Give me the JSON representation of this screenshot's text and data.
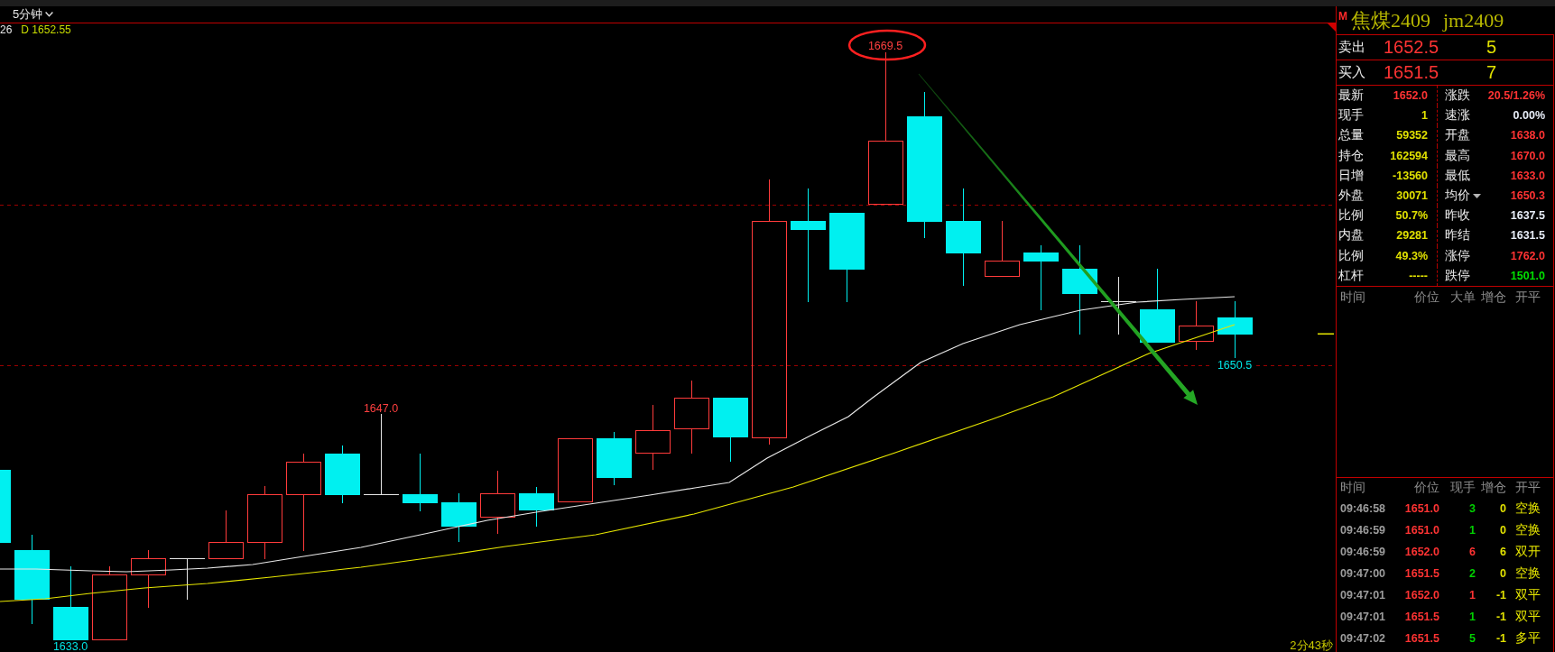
{
  "chart": {
    "timeframe": "5分钟",
    "indicator": {
      "prefix": "26",
      "value": "D 1652.55"
    },
    "price_labels": [
      {
        "kind": "high",
        "text": "1669.5",
        "circled": true
      },
      {
        "kind": "low",
        "text": "1650.5",
        "circled": false
      },
      {
        "kind": "high",
        "text": "1647.0",
        "circled": false
      },
      {
        "kind": "low",
        "text": "1633.0",
        "circled": false
      }
    ],
    "countdown": "2分43秒"
  },
  "quote": {
    "badge": "M",
    "name": "焦煤2409",
    "code": "jm2409",
    "ask": {
      "label": "卖出",
      "price": "1652.5",
      "volume": "5"
    },
    "bid": {
      "label": "买入",
      "price": "1651.5",
      "volume": "7"
    },
    "stats": [
      {
        "label": "最新",
        "value": "1652.0",
        "color": "#ff3333",
        "dropdown": false
      },
      {
        "label": "涨跌",
        "value": "20.5/1.26%",
        "color": "#ff3333",
        "dropdown": false
      },
      {
        "label": "现手",
        "value": "1",
        "color": "#e0e000",
        "dropdown": false
      },
      {
        "label": "速涨",
        "value": "0.00%",
        "color": "#e8eef8",
        "dropdown": false
      },
      {
        "label": "总量",
        "value": "59352",
        "color": "#e0e000",
        "dropdown": false
      },
      {
        "label": "开盘",
        "value": "1638.0",
        "color": "#ff3333",
        "dropdown": false
      },
      {
        "label": "持仓",
        "value": "162594",
        "color": "#e0e000",
        "dropdown": false
      },
      {
        "label": "最高",
        "value": "1670.0",
        "color": "#ff3333",
        "dropdown": false
      },
      {
        "label": "日增",
        "value": "-13560",
        "color": "#e0e000",
        "dropdown": false
      },
      {
        "label": "最低",
        "value": "1633.0",
        "color": "#ff3333",
        "dropdown": false
      },
      {
        "label": "外盘",
        "value": "30071",
        "color": "#e0e000",
        "dropdown": false
      },
      {
        "label": "均价",
        "value": "1650.3",
        "color": "#ff3333",
        "dropdown": true
      },
      {
        "label": "比例",
        "value": "50.7%",
        "color": "#e0e000",
        "dropdown": false
      },
      {
        "label": "昨收",
        "value": "1637.5",
        "color": "#e8eef8",
        "dropdown": false
      },
      {
        "label": "内盘",
        "value": "29281",
        "color": "#e0e000",
        "dropdown": false
      },
      {
        "label": "昨结",
        "value": "1631.5",
        "color": "#e8eef8",
        "dropdown": false
      },
      {
        "label": "比例",
        "value": "49.3%",
        "color": "#e0e000",
        "dropdown": false
      },
      {
        "label": "涨停",
        "value": "1762.0",
        "color": "#ff3333",
        "dropdown": false
      },
      {
        "label": "杠杆",
        "value": "-----",
        "color": "#e0e000",
        "dropdown": false
      },
      {
        "label": "跌停",
        "value": "1501.0",
        "color": "#00e000",
        "dropdown": false
      }
    ],
    "book_columns": [
      "时间",
      "价位",
      "大单",
      "增仓",
      "开平"
    ]
  },
  "trades": {
    "columns": [
      "时间",
      "价位",
      "现手",
      "增仓",
      "开平"
    ],
    "rows": [
      {
        "time": "09:46:58",
        "price": "1651.0",
        "volume": "3",
        "color": "#00d000",
        "change": "0",
        "type": "空换"
      },
      {
        "time": "09:46:59",
        "price": "1651.0",
        "volume": "1",
        "color": "#00d000",
        "change": "0",
        "type": "空换"
      },
      {
        "time": "09:46:59",
        "price": "1652.0",
        "volume": "6",
        "color": "#ff3333",
        "change": "6",
        "type": "双开"
      },
      {
        "time": "09:47:00",
        "price": "1651.5",
        "volume": "2",
        "color": "#00d000",
        "change": "0",
        "type": "空换"
      },
      {
        "time": "09:47:01",
        "price": "1652.0",
        "volume": "1",
        "color": "#ff3333",
        "change": "-1",
        "type": "双平"
      },
      {
        "time": "09:47:01",
        "price": "1651.5",
        "volume": "1",
        "color": "#00d000",
        "change": "-1",
        "type": "双平"
      },
      {
        "time": "09:47:02",
        "price": "1651.5",
        "volume": "5",
        "color": "#00d000",
        "change": "-1",
        "type": "多平"
      }
    ]
  }
}
